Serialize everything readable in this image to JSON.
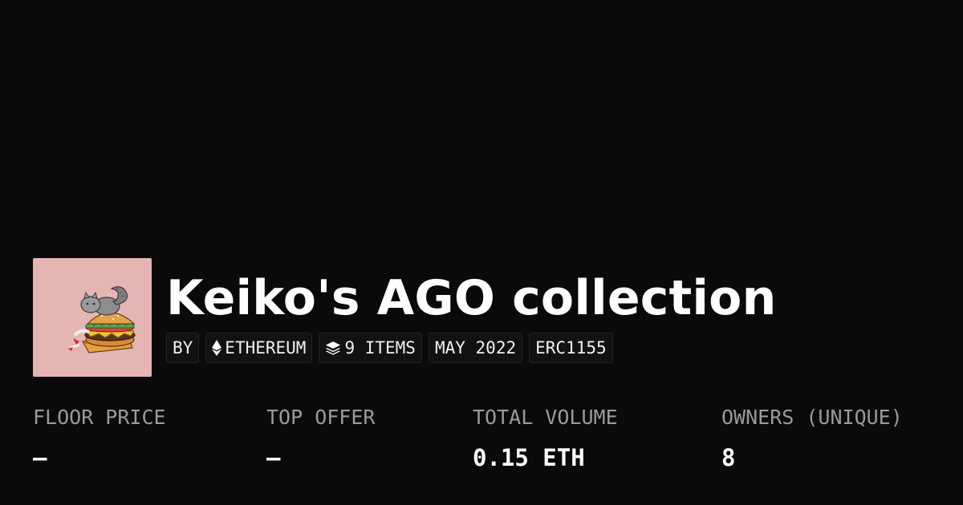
{
  "collection": {
    "title": "Keiko's AGO collection",
    "avatar_bg": "#e5b5b3",
    "avatar_alt": "collection-image"
  },
  "chips": {
    "by": "BY",
    "chain": "ETHEREUM",
    "chain_icon": "ethereum-icon",
    "items": "9 ITEMS",
    "items_icon": "layers-icon",
    "date": "MAY 2022",
    "standard": "ERC1155"
  },
  "stats": {
    "floor_price": {
      "label": "FLOOR PRICE",
      "value": "—"
    },
    "top_offer": {
      "label": "TOP OFFER",
      "value": "—"
    },
    "total_volume": {
      "label": "TOTAL VOLUME",
      "value": "0.15 ETH"
    },
    "owners": {
      "label": "OWNERS (UNIQUE)",
      "value": "8"
    }
  },
  "colors": {
    "background": "#0a0a0a",
    "label": "#9a9a9a",
    "text": "#ffffff"
  }
}
